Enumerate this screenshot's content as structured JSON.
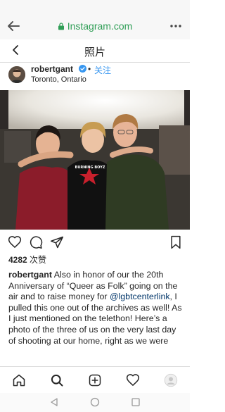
{
  "browser": {
    "url": "Instagram.com",
    "icons": [
      "back-arrow-icon",
      "lock-icon",
      "more-dots-icon"
    ]
  },
  "header": {
    "title": "照片"
  },
  "post": {
    "username": "robertgant",
    "separator": "•",
    "follow_label": "关注",
    "location": "Toronto, Ontario",
    "likes_count": "4282",
    "likes_label": "次赞",
    "caption_user": "robertgant",
    "caption_text_1": " Also in honor of our the 20th Anniversary of “Queer as Folk” going on the air and to raise money for ",
    "caption_mention": "@lgbtcenterlink",
    "caption_text_2": ", I pulled this one out of the archives as well! As I just mentioned on the telethon! Here’s a photo of the three of us on the very last day of shooting at our home, right as we were",
    "shirt_text": "BURNING BOYZ"
  },
  "colors": {
    "link": "#3897f0",
    "url_green": "#2f9e56",
    "mention": "#003569"
  }
}
